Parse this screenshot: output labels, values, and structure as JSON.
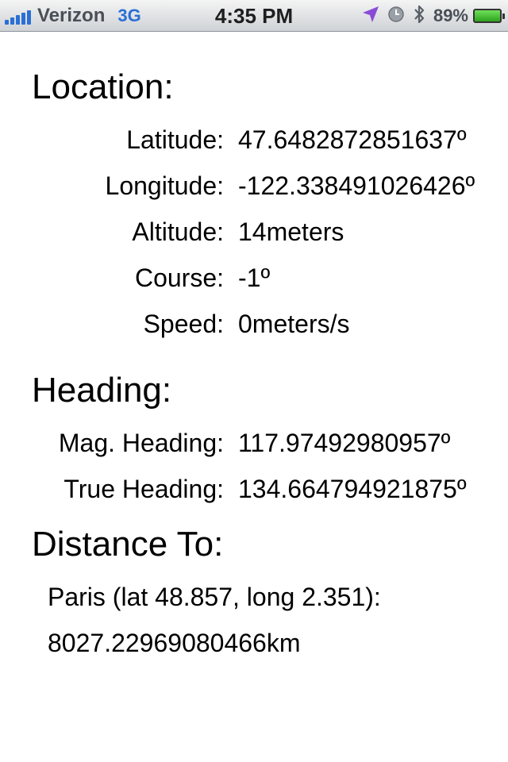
{
  "status_bar": {
    "carrier": "Verizon",
    "network": "3G",
    "time": "4:35 PM",
    "battery": "89%",
    "icons": [
      "signal-bars-icon",
      "location-arrow-icon",
      "clock-icon",
      "bluetooth-icon",
      "battery-icon"
    ],
    "colors": {
      "signal": "#2a6fd6",
      "location_arrow": "#8a4bd6",
      "battery_fill": "#3cc02a"
    }
  },
  "location": {
    "title": "Location:",
    "rows": [
      {
        "label": "Latitude:",
        "value": "47.6482872851637º"
      },
      {
        "label": "Longitude:",
        "value": "-122.338491026426º"
      },
      {
        "label": "Altitude:",
        "value": "14meters"
      },
      {
        "label": "Course:",
        "value": "-1º"
      },
      {
        "label": "Speed:",
        "value": "0meters/s"
      }
    ]
  },
  "heading": {
    "title": "Heading:",
    "rows": [
      {
        "label": "Mag. Heading:",
        "value": "117.97492980957º"
      },
      {
        "label": "True Heading:",
        "value": "134.664794921875º"
      }
    ]
  },
  "distance": {
    "title": "Distance To:",
    "destination": "Paris (lat 48.857, long 2.351):",
    "value": "8027.22969080466km"
  }
}
